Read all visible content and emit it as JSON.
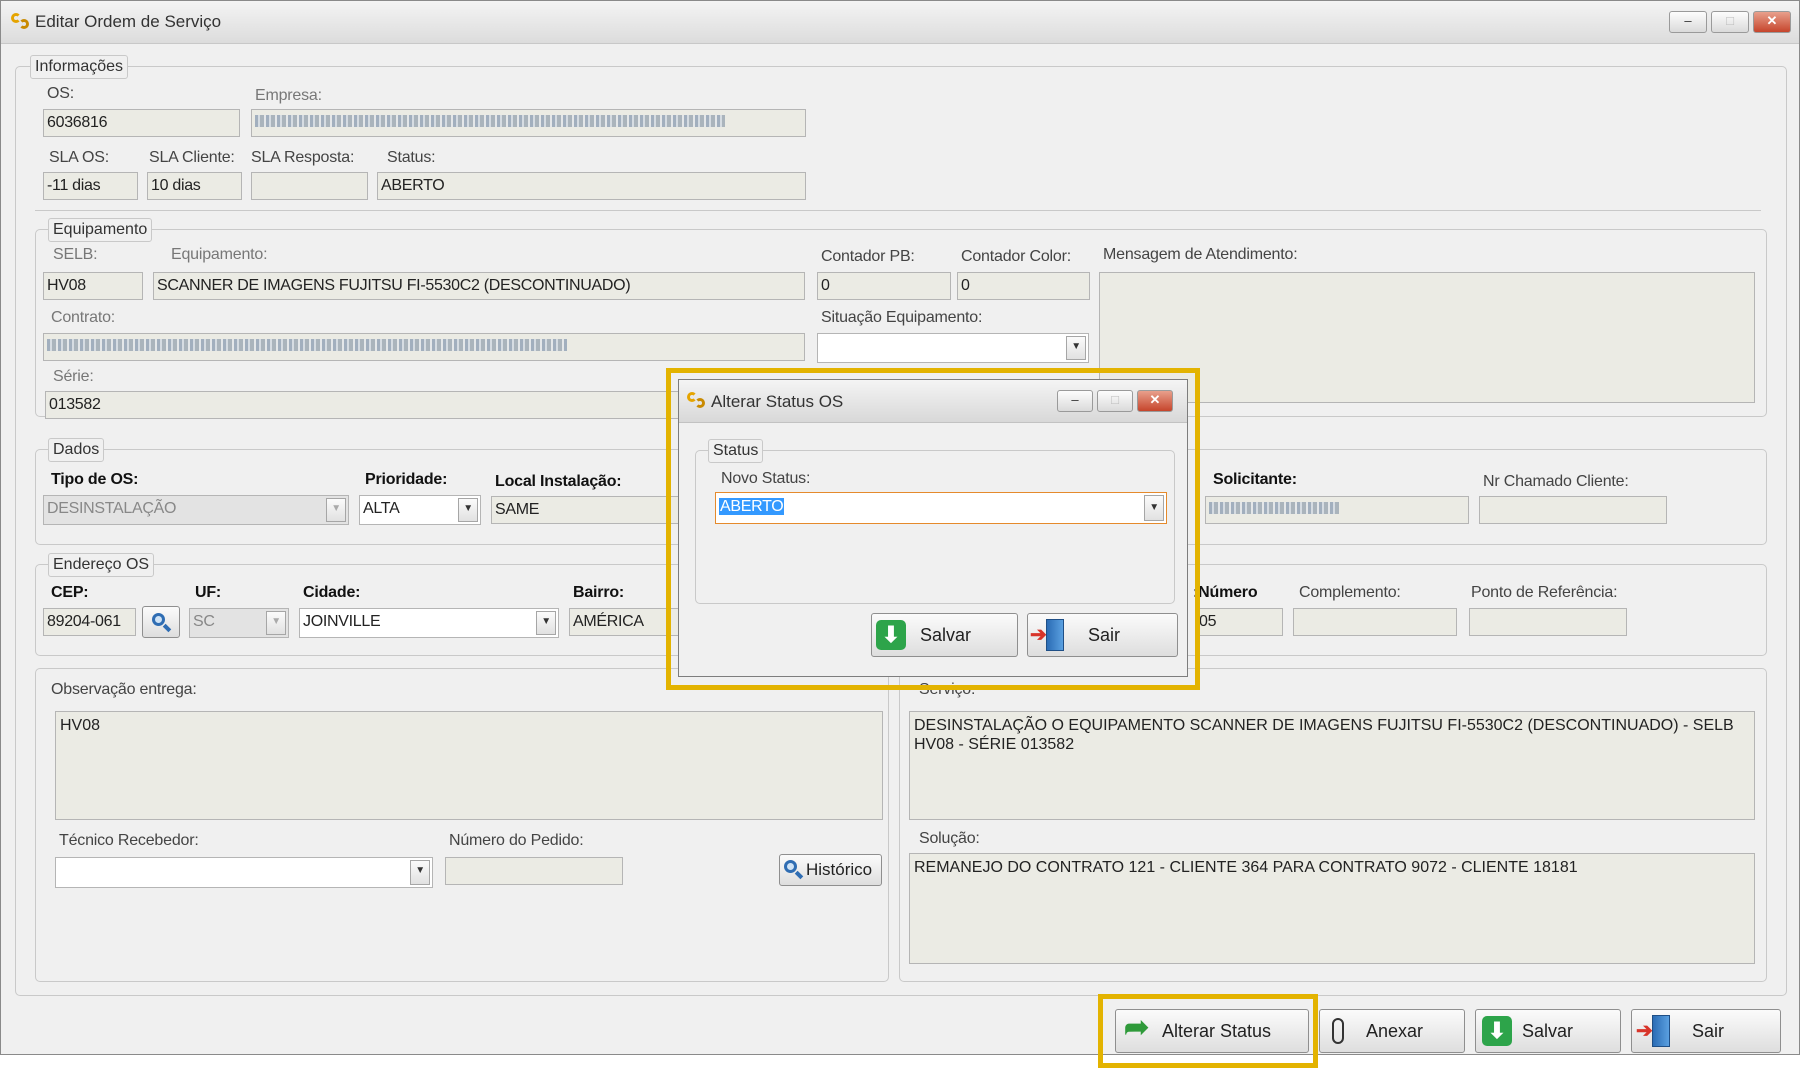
{
  "window": {
    "title": "Editar Ordem de Serviço",
    "controls": {
      "minimize": "–",
      "maximize": "□",
      "close": "✕"
    }
  },
  "informacoes": {
    "legend": "Informações",
    "os_label": "OS:",
    "os_value": "6036816",
    "empresa_label": "Empresa:",
    "sla_os_label": "SLA OS:",
    "sla_os_value": "-11 dias",
    "sla_cliente_label": "SLA Cliente:",
    "sla_cliente_value": "10 dias",
    "sla_resposta_label": "SLA Resposta:",
    "sla_resposta_value": "",
    "status_label": "Status:",
    "status_value": "ABERTO"
  },
  "equipamento": {
    "legend": "Equipamento",
    "selb_label": "SELB:",
    "selb_value": "HV08",
    "equipamento_label": "Equipamento:",
    "equipamento_value": "SCANNER DE IMAGENS FUJITSU FI-5530C2 (DESCONTINUADO)",
    "contador_pb_label": "Contador PB:",
    "contador_pb_value": "0",
    "contador_color_label": "Contador Color:",
    "contador_color_value": "0",
    "mensagem_label": "Mensagem de Atendimento:",
    "contrato_label": "Contrato:",
    "situacao_label": "Situação Equipamento:",
    "situacao_value": "",
    "serie_label": "Série:",
    "serie_value": "013582"
  },
  "dados": {
    "legend": "Dados",
    "tipo_os_label": "Tipo de OS:",
    "tipo_os_value": "DESINSTALAÇÃO",
    "prioridade_label": "Prioridade:",
    "prioridade_value": "ALTA",
    "local_label": "Local Instalação:",
    "local_value": "SAME",
    "solicitante_label": "Solicitante:",
    "nr_chamado_label": "Nr Chamado Cliente:",
    "nr_chamado_value": ""
  },
  "endereco": {
    "legend": "Endereço OS",
    "cep_label": "CEP:",
    "cep_value": "89204-061",
    "uf_label": "UF:",
    "uf_value": "SC",
    "cidade_label": "Cidade:",
    "cidade_value": "JOINVILLE",
    "bairro_label": "Bairro:",
    "bairro_value": "AMÉRICA",
    "numero_label": "Número:",
    "numero_value": "05",
    "complemento_label": "Complemento:",
    "complemento_value": "",
    "referencia_label": "Ponto de Referência:",
    "referencia_value": ""
  },
  "entrega": {
    "observacao_label": "Observação entrega:",
    "observacao_value": "HV08",
    "tecnico_label": "Técnico Recebedor:",
    "tecnico_value": "",
    "pedido_label": "Número do Pedido:",
    "pedido_value": "",
    "historico_button": "Histórico"
  },
  "servico": {
    "servico_label": "Serviço:",
    "servico_value": "DESINSTALAÇÃO O EQUIPAMENTO SCANNER DE IMAGENS FUJITSU FI-5530C2 (DESCONTINUADO) - SELB HV08 - SÉRIE 013582",
    "solucao_label": "Solução:",
    "solucao_value": "REMANEJO DO CONTRATO 121 - CLIENTE 364 PARA CONTRATO 9072 - CLIENTE 18181"
  },
  "bottom_bar": {
    "alterar_status": "Alterar Status",
    "anexar": "Anexar",
    "salvar": "Salvar",
    "sair": "Sair"
  },
  "dialog": {
    "title": "Alterar Status OS",
    "legend": "Status",
    "novo_status_label": "Novo Status:",
    "novo_status_value": "ABERTO",
    "salvar": "Salvar",
    "sair": "Sair"
  },
  "colors": {
    "highlight": "#e3b300",
    "field_bg": "#ebebe4",
    "window_bg": "#f0f0f0"
  }
}
